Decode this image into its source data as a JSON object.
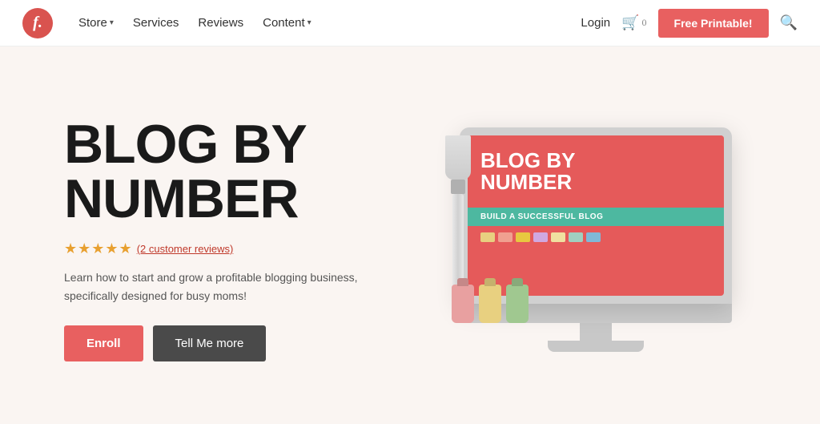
{
  "header": {
    "logo_letter": "f.",
    "nav": {
      "store_label": "Store",
      "services_label": "Services",
      "reviews_label": "Reviews",
      "content_label": "Content"
    },
    "login_label": "Login",
    "cart_count": "0",
    "free_printable_label": "Free Printable!",
    "search_icon": "🔍"
  },
  "hero": {
    "title_line1": "BLOG BY",
    "title_line2": "NUMBER",
    "stars": "★★★★★",
    "review_link": "(2 customer reviews)",
    "description": "Learn how to start and grow a profitable blogging business, specifically designed for busy moms!",
    "enroll_label": "Enroll",
    "tell_more_label": "Tell Me more",
    "screen": {
      "title_line1": "BLOG BY",
      "title_line2": "NUMBER",
      "subtitle": "BUILD A SUCCESSFUL BLOG"
    }
  },
  "colors": {
    "accent_red": "#e86060",
    "accent_teal": "#4db8a0",
    "dot1": "#e8d080",
    "dot2": "#f0a090",
    "dot3": "#e8c840",
    "dot4": "#d0a8e0",
    "dot5": "#f0e0a0",
    "dot6": "#a0d0c0",
    "dot7": "#80b8d8"
  }
}
